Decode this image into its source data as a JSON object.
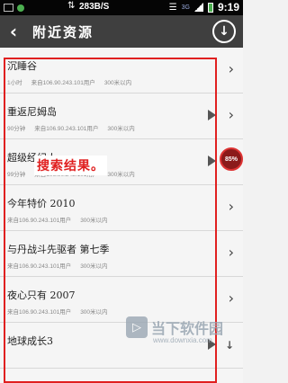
{
  "statusbar": {
    "speed": "283B/S",
    "time": "9:19",
    "network": "3G"
  },
  "header": {
    "title": "附近资源",
    "back_glyph": "‹",
    "download_glyph": "↓"
  },
  "items": [
    {
      "title": "沉睡谷",
      "meta": [
        "1小时",
        "来自106.90.243.101用户",
        "300米以内"
      ],
      "controls": [
        "chevron"
      ]
    },
    {
      "title": "重返尼姆岛",
      "meta": [
        "90分钟",
        "来自106.90.243.101用户",
        "300米以内"
      ],
      "controls": [
        "play",
        "chevron"
      ]
    },
    {
      "title": "超级经纪人",
      "meta": [
        "99分钟",
        "来自106.90.243.101用户",
        "300米以内"
      ],
      "controls": [
        "play",
        "download"
      ]
    },
    {
      "title": "今年特价 2010",
      "meta": [
        "来自106.90.243.101用户",
        "300米以内"
      ],
      "controls": [
        "chevron"
      ]
    },
    {
      "title": "与丹战斗先驱者 第七季",
      "meta": [
        "来自106.90.243.101用户",
        "300米以内"
      ],
      "controls": [
        "chevron"
      ]
    },
    {
      "title": "夜心只有 2007",
      "meta": [
        "来自106.90.243.101用户",
        "300米以内"
      ],
      "controls": [
        "chevron"
      ]
    },
    {
      "title": "地球成长3",
      "meta": [],
      "controls": [
        "play",
        "download"
      ]
    }
  ],
  "annotation": {
    "label": "搜索结果。"
  },
  "progress_badge": {
    "label": "85%",
    "value": 85
  },
  "watermark": {
    "name": "当下软件园",
    "url": "www.downxia.com"
  }
}
